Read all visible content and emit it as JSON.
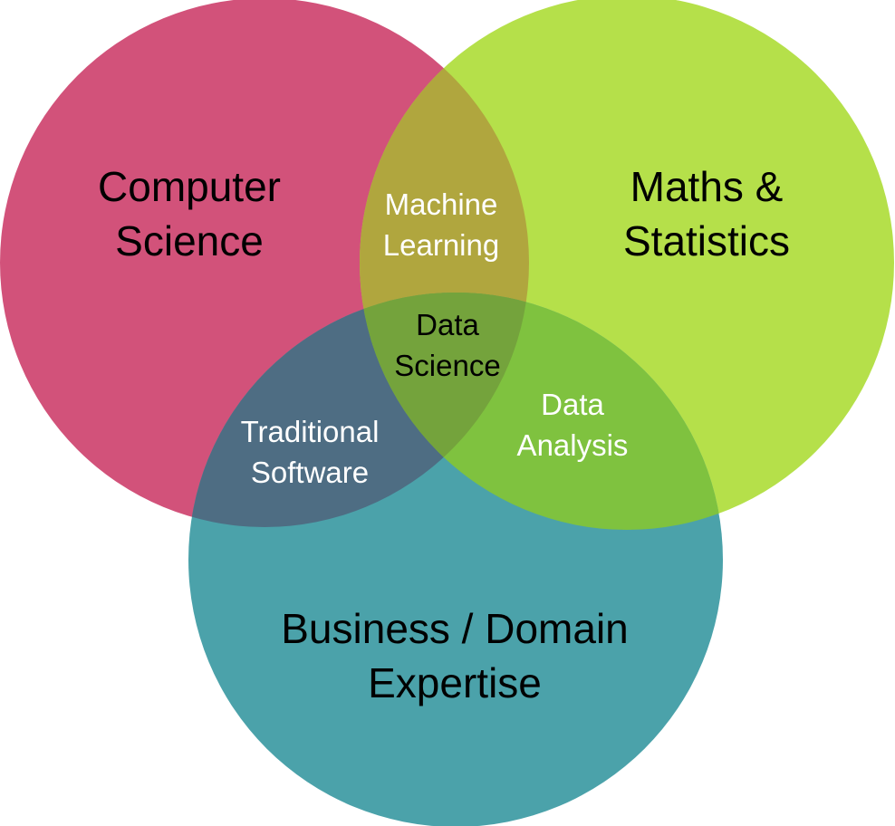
{
  "diagram": {
    "circles": [
      {
        "id": "cs",
        "color": "#d2527a",
        "label_lines": [
          "Computer",
          "Science"
        ]
      },
      {
        "id": "ms",
        "color": "#b5e04a",
        "label_lines": [
          "Maths &",
          "Statistics"
        ]
      },
      {
        "id": "bd",
        "color": "#4ba2aa",
        "label_lines": [
          "Business / Domain",
          "Expertise"
        ]
      }
    ],
    "overlaps": {
      "machine_learning": {
        "lines": [
          "Machine",
          "Learning"
        ],
        "color": "#b0a63e"
      },
      "traditional_software": {
        "lines": [
          "Traditional",
          "Software"
        ],
        "color": "#4e6d83"
      },
      "data_analysis": {
        "lines": [
          "Data",
          "Analysis"
        ],
        "color": "#7fc23f"
      },
      "data_science": {
        "lines": [
          "Data",
          "Science"
        ],
        "color": "#74a33c"
      }
    }
  }
}
